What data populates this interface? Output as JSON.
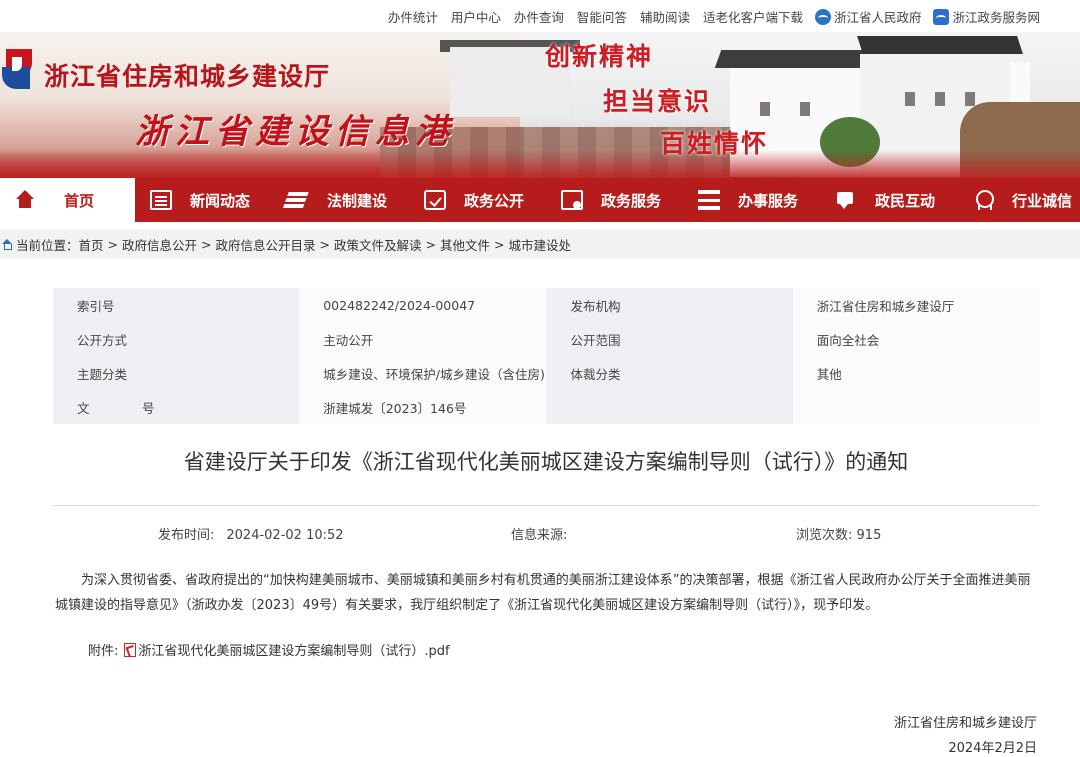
{
  "topbar": {
    "links": [
      "办件统计",
      "用户中心",
      "办件查询",
      "智能问答",
      "辅助阅读",
      "适老化客户端下载"
    ],
    "gov_links": [
      "浙江省人民政府",
      "浙江政务服务网"
    ]
  },
  "banner": {
    "dept_name": "浙江省住房和城乡建设厅",
    "site_name": "浙江省建设信息港",
    "slogans": [
      "创新精神",
      "担当意识",
      "百姓情怀"
    ],
    "colors": {
      "brand_red": "#b71c1c",
      "logo_blue": "#1d4e9c"
    }
  },
  "nav": {
    "items": [
      {
        "label": "首页",
        "icon": "home-icon"
      },
      {
        "label": "新闻动态",
        "icon": "news-icon"
      },
      {
        "label": "法制建设",
        "icon": "layers-icon"
      },
      {
        "label": "政务公开",
        "icon": "check-icon"
      },
      {
        "label": "政务服务",
        "icon": "service-icon"
      },
      {
        "label": "办事服务",
        "icon": "server-icon"
      },
      {
        "label": "政民互动",
        "icon": "chat-icon"
      },
      {
        "label": "行业诚信",
        "icon": "medal-icon"
      }
    ],
    "active_index": 0
  },
  "breadcrumb": {
    "prefix": "当前位置：",
    "items": [
      "首页",
      "政府信息公开",
      "政府信息公开目录",
      "政策文件及解读",
      "其他文件",
      "城市建设处"
    ],
    "separator": ">"
  },
  "meta": {
    "rows": [
      [
        "索引号",
        "002482242/2024-00047",
        "发布机构",
        "浙江省住房和城乡建设厅"
      ],
      [
        "公开方式",
        "主动公开",
        "公开范围",
        "面向全社会"
      ],
      [
        "主题分类",
        "城乡建设、环境保护/城乡建设（含住房)",
        "体裁分类",
        "其他"
      ],
      [
        "文　号",
        "浙建城发〔2023〕146号",
        "",
        ""
      ]
    ]
  },
  "article": {
    "title": "省建设厅关于印发《浙江省现代化美丽城区建设方案编制导则（试行）》的通知",
    "publish_label": "发布时间:",
    "publish_time": "2024-02-02 10:52",
    "source_label": "信息来源:",
    "source_value": "",
    "views_label": "浏览次数:",
    "views": "915",
    "body": "为深入贯彻省委、省政府提出的“加快构建美丽城市、美丽城镇和美丽乡村有机贯通的美丽浙江建设体系”的决策部署，根据《浙江省人民政府办公厅关于全面推进美丽城镇建设的指导意见》（浙政办发〔2023〕49号）有关要求，我厅组织制定了《浙江省现代化美丽城区建设方案编制导则（试行）》，现予印发。",
    "attachment_label": "附件:",
    "attachment_name": "浙江省现代化美丽城区建设方案编制导则（试行）.pdf",
    "signature_org": "浙江省住房和城乡建设厅",
    "signature_date": "2024年2月2日"
  }
}
